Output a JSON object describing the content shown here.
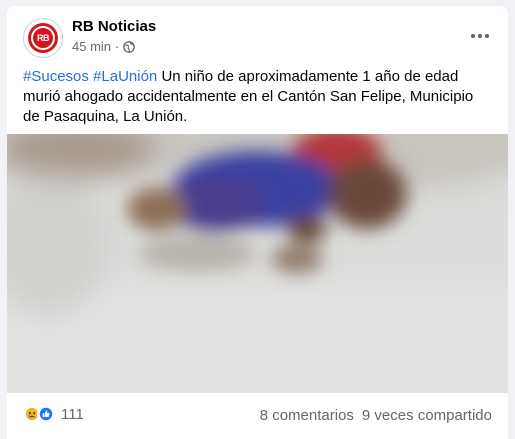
{
  "post": {
    "page_name": "RB Noticias",
    "avatar_text": "RB",
    "time": "45 min",
    "separator": "·",
    "audience_icon": "globe-icon",
    "more_icon": "more-horizontal-icon",
    "hashtag_1": "#Sucesos",
    "hashtag_2": "#LaUnión",
    "body": "Un niño de aproximadamente 1 año de edad murió ahogado accidentalmente en el Cantón San Felipe, Municipio de Pasaquina, La Unión.",
    "image_description_icon": "blurred-photo"
  },
  "footer": {
    "reaction_icons": [
      "sad-reaction-icon",
      "like-reaction-icon"
    ],
    "reaction_count": "111",
    "comments": "8 comentarios",
    "shares": "9 veces compartido"
  },
  "colors": {
    "brand_red": "#d4151c",
    "link_blue": "#216fdb",
    "like_blue": "#1877f2",
    "sad_yellow": "#f7b125",
    "secondary_text": "#65676b"
  }
}
